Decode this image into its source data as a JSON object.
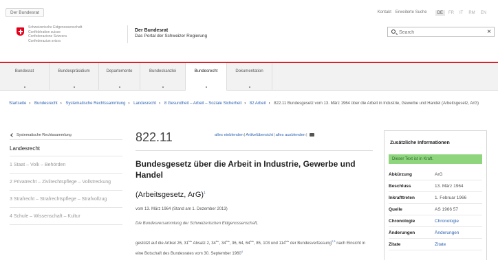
{
  "top": {
    "federal_tab": "Der Bundesrat",
    "links": [
      "Kontakt",
      "Erweiterte Suche"
    ],
    "languages": [
      "DE",
      "FR",
      "IT",
      "RM",
      "EN"
    ],
    "active_language": "DE"
  },
  "header": {
    "confederation_lines": [
      "Schweizerische Eidgenossenschaft",
      "Confédération suisse",
      "Confederazione Svizzera",
      "Confederaziun svizra"
    ],
    "portal_title": "Der Bundesrat",
    "portal_subtitle": "Das Portal der Schweizer Regierung",
    "search": {
      "placeholder": "Search",
      "clear": "×"
    }
  },
  "nav": {
    "items": [
      "Bundesrat",
      "Bundespräsidium",
      "Departemente",
      "Bundeskanzlei",
      "Bundesrecht",
      "Dokumentation"
    ],
    "active": "Bundesrecht"
  },
  "breadcrumb": {
    "items": [
      "Startseite",
      "Bundesrecht",
      "Systematische Rechtssammlung",
      "Landesrecht",
      "8 Gesundheit – Arbeit – Soziale Sicherheit",
      "82 Arbeit"
    ],
    "current": "822.11 Bundesgesetz vom 13. März 1964 über die Arbeit in Industrie, Gewerbe und Handel (Arbeitsgesetz, ArG)"
  },
  "sidebar": {
    "back_link": "Systematische Rechtssammlung",
    "title": "Landesrecht",
    "items": [
      "1 Staat – Volk – Behörden",
      "2 Privatrecht – Zivilrechtspflege – Vollstreckung",
      "3 Strafrecht – Strafrechtspflege – Strafvollzug",
      "4 Schule – Wissenschaft – Kultur"
    ]
  },
  "main": {
    "sr_number": "822.11",
    "toolbar": [
      "alles einblenden",
      "Artikelübersicht",
      "alles ausblenden"
    ],
    "title": "Bundesgesetz über die Arbeit in Industrie, Gewerbe und Handel",
    "short_title": "(Arbeitsgesetz, ArG)",
    "short_title_sup": "1",
    "date_line": "vom 13. März 1964 (Stand am 1. Dezember 2013)",
    "intro": "Die Bundesversammlung der Schweizerischen Eidgenossenschaft,",
    "basis_1": "gestützt auf die Artikel 26, 31",
    "basis_sup_1": "bis",
    "basis_2": " Absatz 2, 34",
    "basis_sup_2": "ter",
    "basis_3": ", 34",
    "basis_sup_3": "bis",
    "basis_4": ", 36, 64, 64",
    "basis_sup_4": "bis",
    "basis_5": ", 85, 103 und 114",
    "basis_sup_5": "bis",
    "basis_6": " der Bundesverfassung",
    "basis_fn": "2,3",
    "basis_7": " nach Einsicht in eine Botschaft des Bundesrates vom 30. September 1960",
    "basis_fn2": "4"
  },
  "info": {
    "title": "Zusätzliche Informationen",
    "status": "Dieser Text ist in Kraft.",
    "rows": [
      {
        "label": "Abkürzung",
        "value": "ArG"
      },
      {
        "label": "Beschluss",
        "value": "13. März 1964"
      },
      {
        "label": "Inkrafttreten",
        "value": "1. Februar 1966"
      },
      {
        "label": "Quelle",
        "value": "AS 1966 57"
      },
      {
        "label": "Chronologie",
        "value": "Chronologie"
      },
      {
        "label": "Änderungen",
        "value": "Änderungen"
      },
      {
        "label": "Zitate",
        "value": "Zitate"
      }
    ]
  }
}
